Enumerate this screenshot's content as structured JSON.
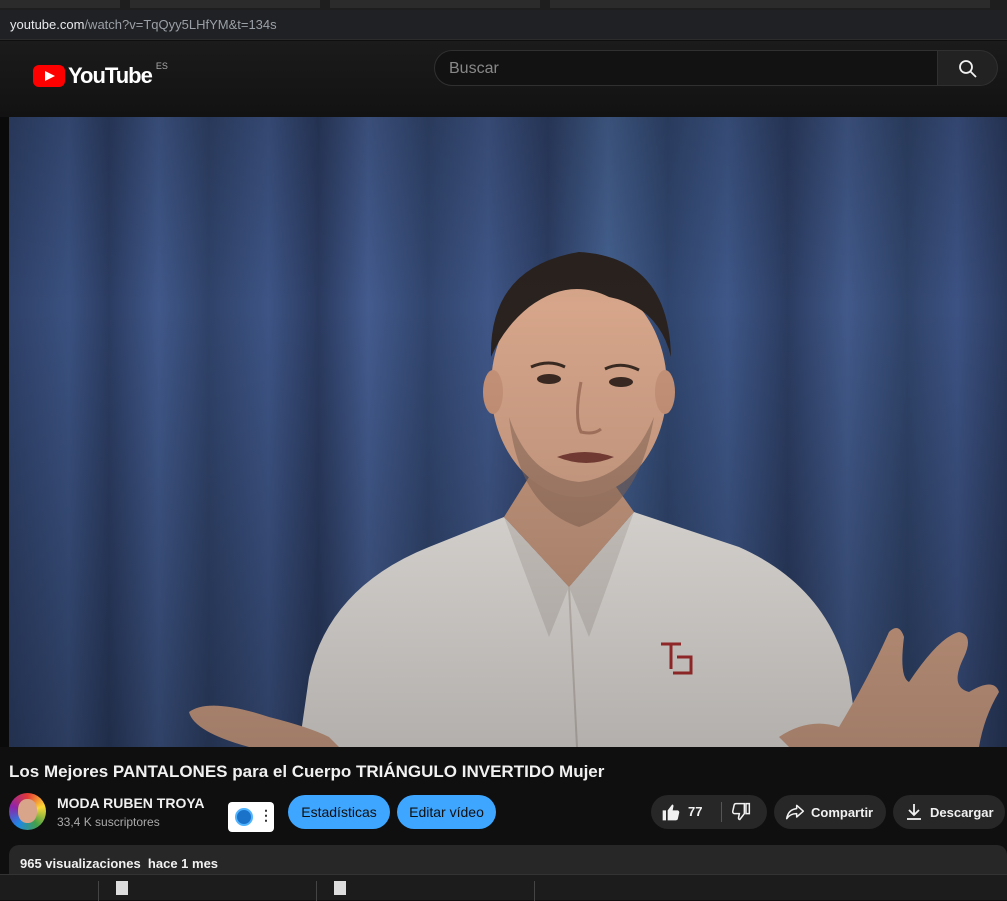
{
  "browser": {
    "url_host": "youtube.com",
    "url_path": "/watch?v=TqQyy5LHfYM&t=134s"
  },
  "header": {
    "logo_text": "YouTube",
    "region": "ES",
    "search_placeholder": "Buscar"
  },
  "video": {
    "title": "Los Mejores PANTALONES para el Cuerpo TRIÁNGULO INVERTIDO Mujer"
  },
  "channel": {
    "name": "MODA RUBEN TROYA",
    "subscribers": "33,4 K suscriptores"
  },
  "actions": {
    "stats_label": "Estadísticas",
    "edit_label": "Editar vídeo",
    "like_count": "77",
    "share_label": "Compartir",
    "download_label": "Descargar"
  },
  "description": {
    "views": "965 visualizaciones",
    "date": "hace 1 mes"
  },
  "colors": {
    "accent_blue": "#3ea6ff",
    "youtube_red": "#ff0000",
    "background": "#0f0f0f"
  }
}
